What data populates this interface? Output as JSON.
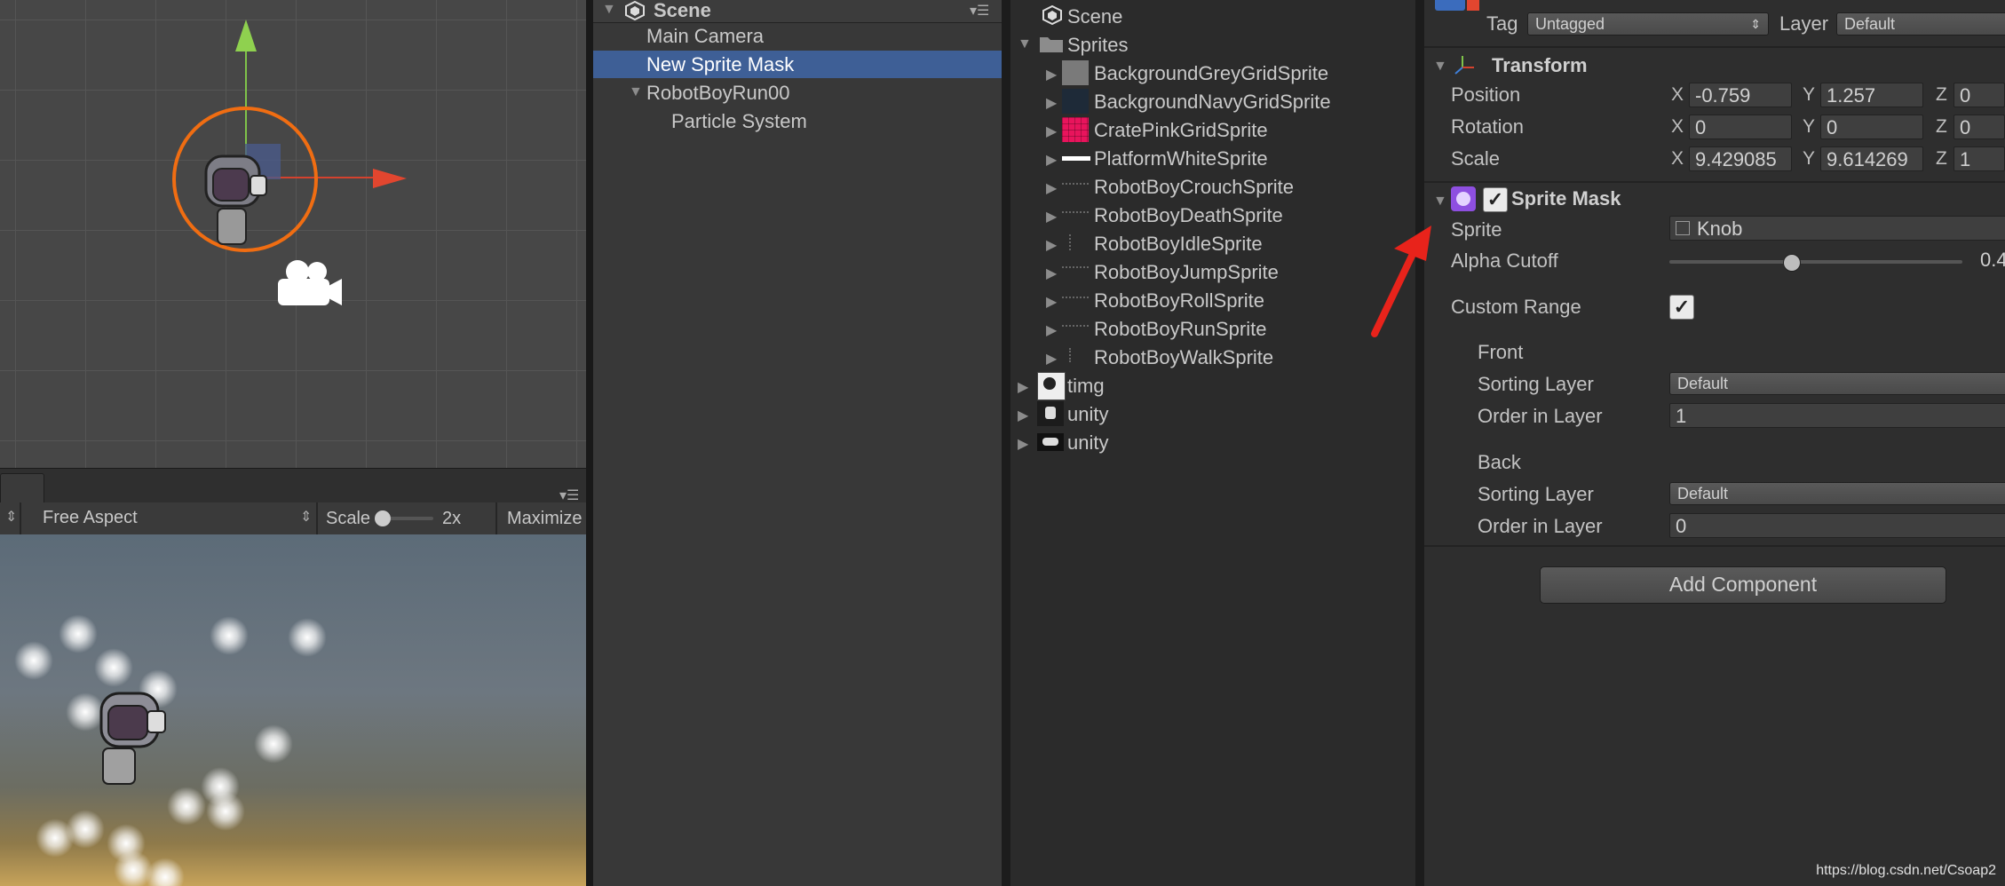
{
  "hierarchy": {
    "scene_name": "Scene",
    "items": [
      "Main Camera",
      "New Sprite Mask",
      "RobotBoyRun00",
      "Particle System"
    ]
  },
  "game_view": {
    "aspect": "Free Aspect",
    "scale_label": "Scale",
    "scale_value": "2x",
    "maximize_label": "Maximize"
  },
  "project": {
    "items": [
      {
        "label": "Scene",
        "icon": "unity-scene-icon"
      },
      {
        "label": "Sprites",
        "icon": "folder-icon"
      },
      {
        "label": "BackgroundGreyGridSprite",
        "icon": "grey-grid-thumbnail",
        "color": "#7a7a7a"
      },
      {
        "label": "BackgroundNavyGridSprite",
        "icon": "navy-grid-thumbnail",
        "color": "#1e2a38"
      },
      {
        "label": "CratePinkGridSprite",
        "icon": "pink-grid-thumbnail",
        "color": "#e8145c"
      },
      {
        "label": "PlatformWhiteSprite",
        "icon": "white-platform-thumbnail",
        "color": "#ffffff"
      },
      {
        "label": "RobotBoyCrouchSprite",
        "icon": "sprite-sheet-thumbnail"
      },
      {
        "label": "RobotBoyDeathSprite",
        "icon": "sprite-sheet-thumbnail"
      },
      {
        "label": "RobotBoyIdleSprite",
        "icon": "sprite-sheet-thumbnail"
      },
      {
        "label": "RobotBoyJumpSprite",
        "icon": "sprite-sheet-thumbnail"
      },
      {
        "label": "RobotBoyRollSprite",
        "icon": "sprite-sheet-thumbnail"
      },
      {
        "label": "RobotBoyRunSprite",
        "icon": "sprite-sheet-thumbnail"
      },
      {
        "label": "RobotBoyWalkSprite",
        "icon": "sprite-sheet-thumbnail"
      },
      {
        "label": "timg",
        "icon": "image-thumbnail"
      },
      {
        "label": "unity",
        "icon": "image-thumbnail"
      },
      {
        "label": "unity",
        "icon": "image-thumbnail"
      }
    ]
  },
  "inspector": {
    "tag_label": "Tag",
    "tag_value": "Untagged",
    "layer_label": "Layer",
    "layer_value": "Default",
    "transform": {
      "title": "Transform",
      "rows": [
        {
          "label": "Position",
          "x": "-0.759",
          "y": "1.257",
          "z": "0"
        },
        {
          "label": "Rotation",
          "x": "0",
          "y": "0",
          "z": "0"
        },
        {
          "label": "Scale",
          "x": "9.429085",
          "y": "9.614269",
          "z": "1"
        }
      ],
      "axis_x": "X",
      "axis_y": "Y",
      "axis_z": "Z"
    },
    "sprite_mask": {
      "title": "Sprite Mask",
      "enabled": true,
      "sprite_label": "Sprite",
      "sprite_value": "Knob",
      "alpha_cutoff_label": "Alpha Cutoff",
      "alpha_cutoff_value": "0.4",
      "alpha_cutoff_fraction": 0.4,
      "custom_range_label": "Custom Range",
      "custom_range_checked": true,
      "front_label": "Front",
      "front_sorting_layer_label": "Sorting Layer",
      "front_sorting_layer_value": "Default",
      "front_order_label": "Order in Layer",
      "front_order_value": "1",
      "back_label": "Back",
      "back_sorting_layer_label": "Sorting Layer",
      "back_sorting_layer_value": "Default",
      "back_order_label": "Order in Layer",
      "back_order_value": "0"
    },
    "add_component_label": "Add Component"
  },
  "colors": {
    "selection": "#3e5f96",
    "annotation_arrow": "#e8231b",
    "gizmo_circle": "#f06d12"
  },
  "watermark": "https://blog.csdn.net/Csoap2"
}
